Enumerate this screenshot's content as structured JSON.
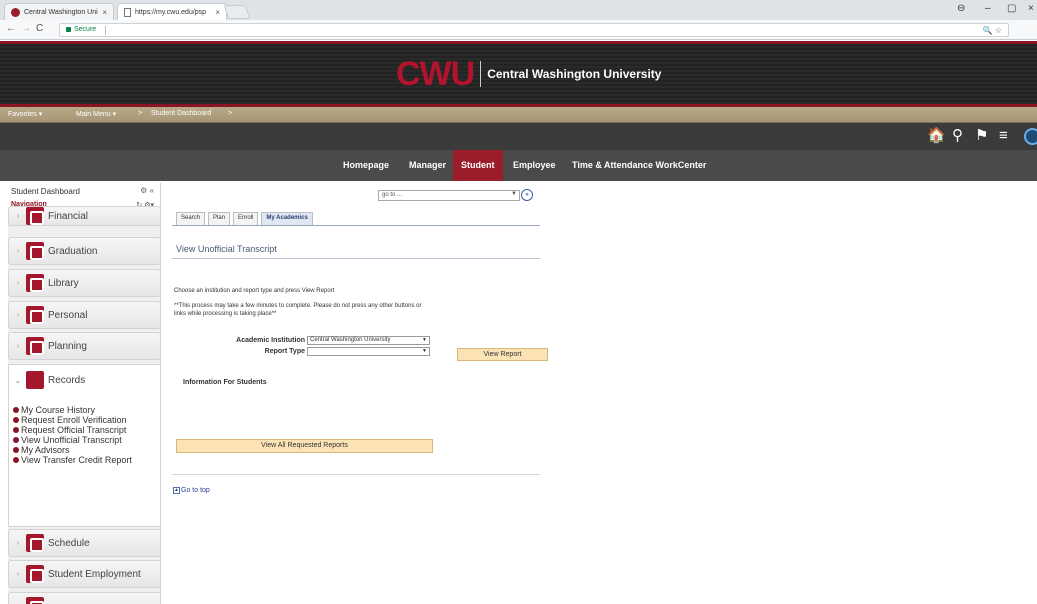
{
  "browser": {
    "tab1_title": "Central Washington Uni",
    "tab2_title": "https://my.cwu.edu/psp",
    "secure_label": "Secure",
    "tab_close": "×",
    "nav_back": "←",
    "nav_forward": "→",
    "reload": "C",
    "omnibox_icons": "🔍 ☆",
    "window_controls": {
      "account": "⊖",
      "minimize": "–",
      "restore": "▢",
      "close": "×"
    }
  },
  "banner": {
    "logo_mark": "CWU",
    "university_name": "Central Washington University"
  },
  "favbar": {
    "favorites": "Favorites ▾",
    "main_menu": "Main Menu ▾",
    "crumb_sep": ">",
    "crumb": "Student Dashboard",
    "crumb_end": ">"
  },
  "iconbar": {
    "home": "🏠",
    "search": "⚲",
    "flag": "⚑",
    "menu": "≡"
  },
  "menubar": {
    "items": [
      "Homepage",
      "Manager",
      "Student",
      "Employee",
      "Time & Attendance WorkCenter"
    ]
  },
  "sidebar": {
    "title": "Student Dashboard",
    "title_controls": "⚙ «",
    "nav_label": "Navigation",
    "nav_controls": "↻ ⚙▾",
    "chevron": "›",
    "chevron_open": "⌄",
    "items": [
      "Financial",
      "Graduation",
      "Library",
      "Personal",
      "Planning",
      "Records",
      "Schedule",
      "Student Employment"
    ],
    "records_links": [
      "My Course History",
      "Request Enroll Verification",
      "Request Official Transcript",
      "View Unofficial Transcript",
      "My Advisors",
      "View Transfer Credit Report"
    ]
  },
  "main": {
    "goto_value": "go to ...",
    "goto_dd": "▼",
    "goto_btn": "»",
    "tabs": [
      "Search",
      "Plan",
      "Enroll",
      "My Academics"
    ],
    "page_title": "View Unofficial Transcript",
    "instruction": "Choose an institution and report type and press View Report",
    "note": "**This process may take a few minutes to complete. Please do not press any other buttons or links while processing is taking place**",
    "institution_label": "Academic Institution",
    "institution_value": "Central Washington University",
    "report_type_label": "Report Type",
    "report_type_value": "",
    "select_dd": "▼",
    "view_report_button": "View Report",
    "info_heading": "Information For Students",
    "view_all_button": "View All Requested Reports",
    "go_to_top": "Go to top",
    "go_to_top_icon": "▲"
  }
}
